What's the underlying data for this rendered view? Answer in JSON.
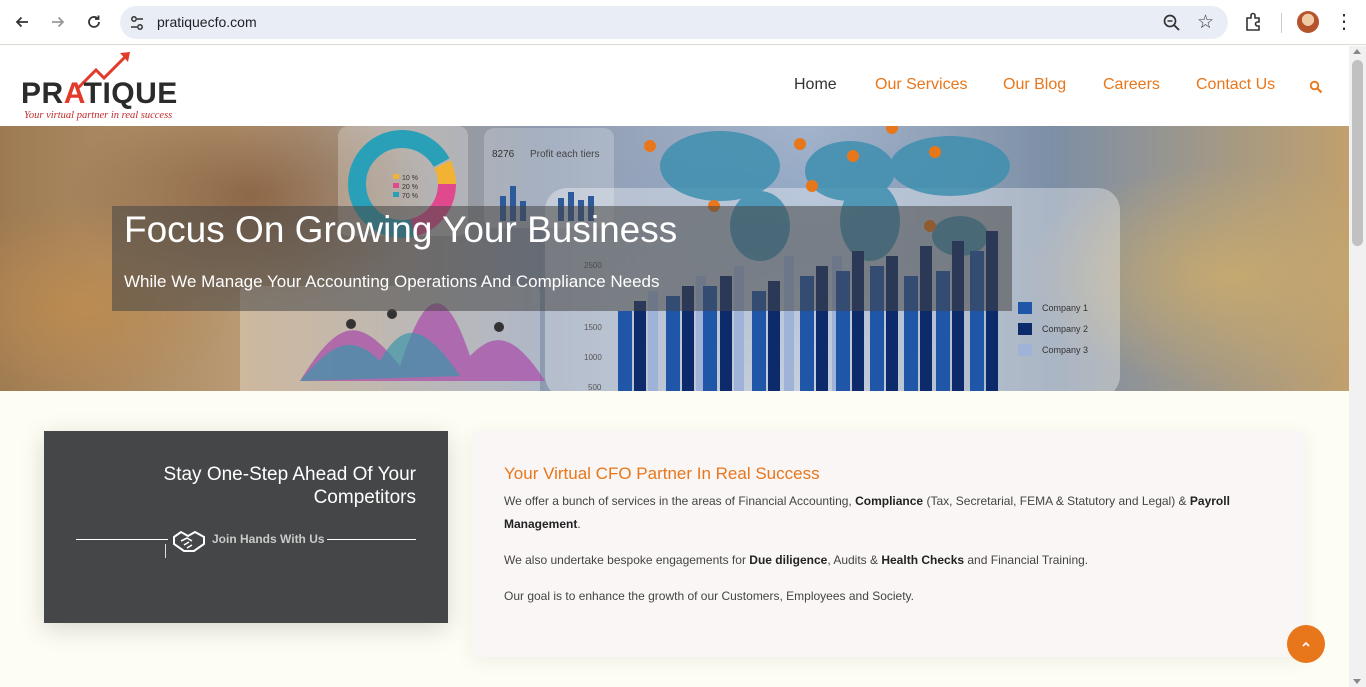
{
  "browser": {
    "url": "pratiquecfo.com",
    "icons": [
      "back-arrow-icon",
      "forward-arrow-icon",
      "reload-icon",
      "site-settings-icon",
      "zoom-icon",
      "bookmark-star-icon",
      "extensions-icon",
      "profile-avatar",
      "more-menu-icon"
    ]
  },
  "logo": {
    "word_start": "PR",
    "word_accent": "A",
    "word_end": "TIQUE",
    "tagline": "Your virtual partner in real success"
  },
  "nav": {
    "items": [
      "Home",
      "Our Services",
      "Our Blog",
      "Careers",
      "Contact Us"
    ],
    "active": "Home"
  },
  "hero": {
    "title": "Focus On Growing Your Business",
    "subtitle": "While We Manage Your Accounting Operations And Compliance Needs",
    "image_text": {
      "profit_value": "8276",
      "profit_label": "Profit each tiers",
      "pie_legend": [
        "10 %",
        "20 %",
        "70 %"
      ],
      "axis_ticks": [
        "2500",
        "1500",
        "1000",
        "500"
      ],
      "companies": [
        "Company 1",
        "Company 2",
        "Company 3"
      ]
    }
  },
  "cta": {
    "title": "Stay One-Step Ahead Of Your Competitors",
    "join": "Join Hands With Us"
  },
  "about": {
    "title": "Your Virtual CFO Partner In Real Success",
    "p1_a": "We offer a bunch of services in the areas of Financial Accounting, ",
    "p1_b": "Compliance",
    "p1_c": " (Tax, Secretarial, FEMA & Statutory and Legal) & ",
    "p1_d": "Payroll Management",
    "p1_e": ".",
    "p2_a": "We also undertake bespoke engagements for ",
    "p2_b": "Due diligence",
    "p2_c": ", Audits & ",
    "p2_d": "Health Checks",
    "p2_e": " and Financial Training.",
    "p3": "Our goal is to enhance the growth of our Customers, Employees and Society."
  },
  "colors": {
    "accent": "#e8761b",
    "dark_card": "#444647",
    "logo_red": "#e23a2b"
  }
}
